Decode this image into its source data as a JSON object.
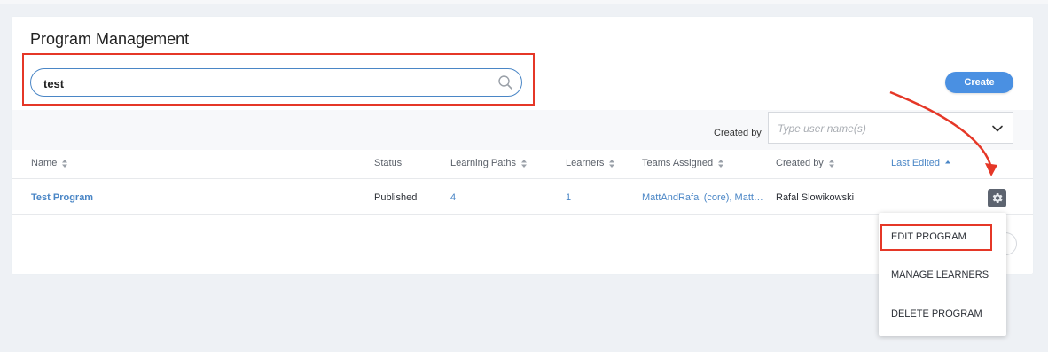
{
  "page": {
    "title": "Program Management"
  },
  "search": {
    "value": "test",
    "icon": "search-icon"
  },
  "toolbar": {
    "create_label": "Create"
  },
  "filter": {
    "created_by_label": "Created by",
    "user_placeholder": "Type user name(s)"
  },
  "table": {
    "columns": {
      "name": "Name",
      "status": "Status",
      "learning_paths": "Learning Paths",
      "learners": "Learners",
      "teams_assigned": "Teams Assigned",
      "created_by": "Created by",
      "last_edited": "Last Edited"
    },
    "sorted_column": "Last Edited",
    "rows": [
      {
        "name": "Test Program",
        "status": "Published",
        "learning_paths": "4",
        "learners": "1",
        "teams_assigned": "MattAndRafal (core), Matt…",
        "created_by": "Rafal Slowikowski",
        "last_edited": ""
      }
    ]
  },
  "actions_menu": {
    "items": [
      "EDIT PROGRAM",
      "MANAGE LEARNERS",
      "DELETE PROGRAM"
    ]
  },
  "colors": {
    "accent": "#4a90e2",
    "link": "#4a86c6",
    "highlight": "#e53727",
    "background": "#eef1f5"
  }
}
